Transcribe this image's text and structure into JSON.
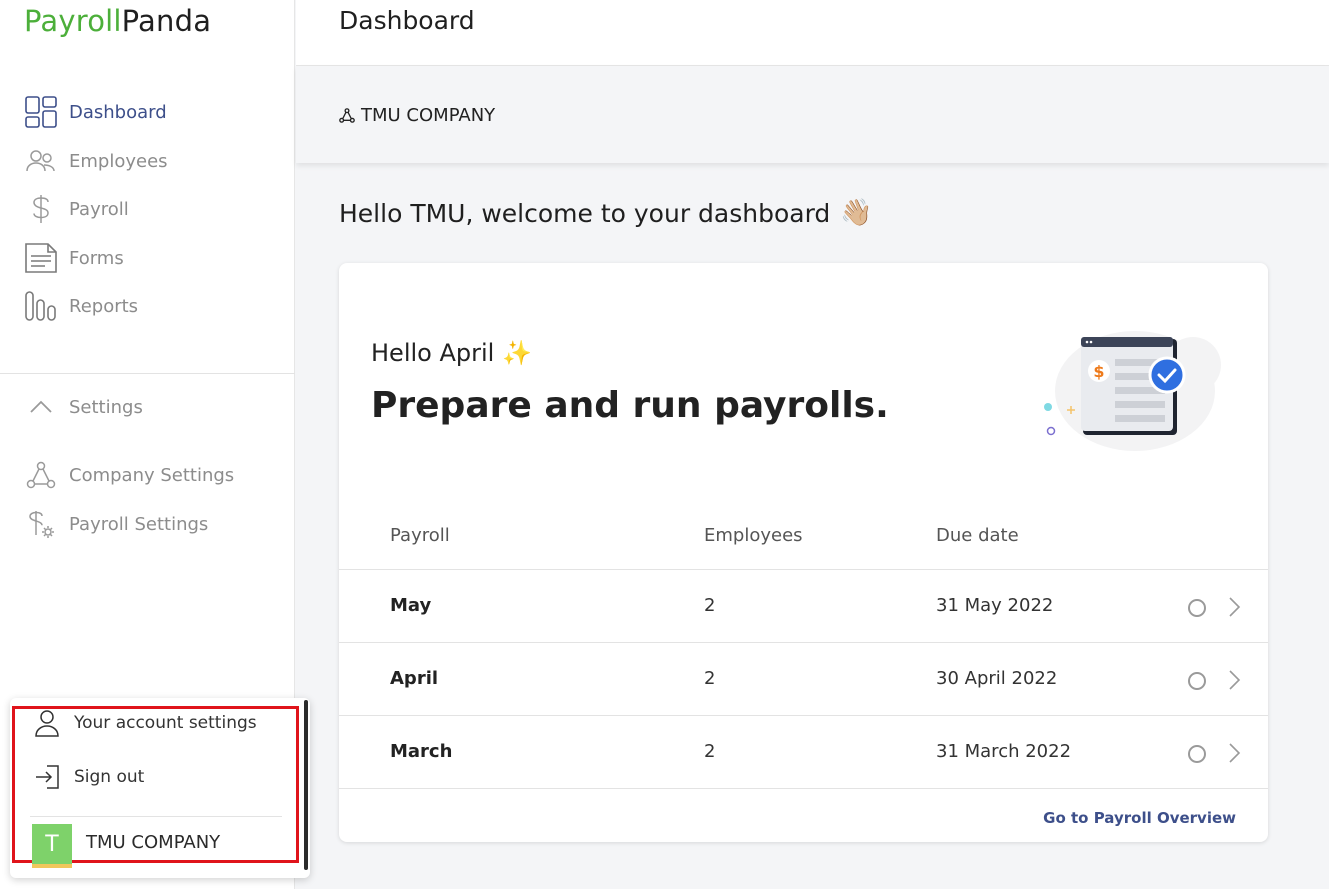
{
  "brand": {
    "part1": "Payroll",
    "part2": "Panda"
  },
  "sidebar": {
    "items": [
      {
        "label": "Dashboard",
        "active": true
      },
      {
        "label": "Employees"
      },
      {
        "label": "Payroll"
      },
      {
        "label": "Forms"
      },
      {
        "label": "Reports"
      }
    ],
    "settings_label": "Settings",
    "settings_items": [
      {
        "label": "Company Settings"
      },
      {
        "label": "Payroll Settings"
      }
    ]
  },
  "popup": {
    "account_settings": "Your account settings",
    "sign_out": "Sign out",
    "avatar_letter": "T",
    "company": "TMU COMPANY"
  },
  "header": {
    "title": "Dashboard"
  },
  "company_bar": {
    "name": "TMU COMPANY"
  },
  "welcome": {
    "text": "Hello TMU, welcome to your dashboard",
    "emoji": "👋🏼"
  },
  "card": {
    "hello": "Hello April",
    "hello_emoji": "✨",
    "headline": "Prepare and run payrolls.",
    "columns": [
      "Payroll",
      "Employees",
      "Due date"
    ],
    "rows": [
      {
        "payroll": "May",
        "employees": "2",
        "due": "31 May 2022"
      },
      {
        "payroll": "April",
        "employees": "2",
        "due": "30 April 2022"
      },
      {
        "payroll": "March",
        "employees": "2",
        "due": "31 March 2022"
      }
    ],
    "link": "Go to Payroll Overview",
    "illus_symbol": "$"
  },
  "colors": {
    "brand_green": "#4caf3a",
    "accent_blue": "#3d4f8a",
    "highlight_red": "#e0141b",
    "check_blue": "#2f6fe0"
  }
}
